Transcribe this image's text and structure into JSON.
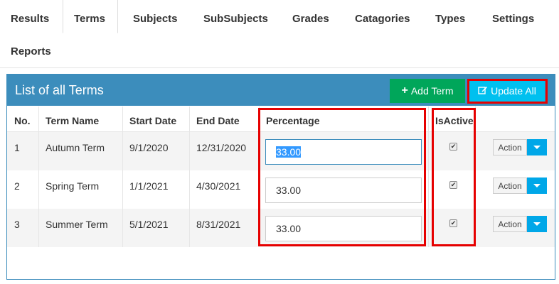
{
  "tabs": [
    {
      "label": "Results",
      "active": false
    },
    {
      "label": "Terms",
      "active": true
    },
    {
      "label": "Subjects",
      "active": false
    },
    {
      "label": "SubSubjects",
      "active": false
    },
    {
      "label": "Grades",
      "active": false
    },
    {
      "label": "Catagories",
      "active": false
    },
    {
      "label": "Types",
      "active": false
    },
    {
      "label": "Settings",
      "active": false
    },
    {
      "label": "Reports",
      "active": false
    }
  ],
  "panel": {
    "title": "List of all Terms",
    "add_label": "Add Term",
    "update_label": "Update All",
    "accent": "#3c8dbc"
  },
  "table": {
    "headers": {
      "no": "No.",
      "name": "Term Name",
      "start": "Start Date",
      "end": "End Date",
      "pct": "Percentage",
      "active": "IsActive"
    },
    "rows": [
      {
        "no": "1",
        "name": "Autumn Term",
        "start": "9/1/2020",
        "end": "12/31/2020",
        "pct": "33.00",
        "active": true,
        "action": "Action"
      },
      {
        "no": "2",
        "name": "Spring Term",
        "start": "1/1/2021",
        "end": "4/30/2021",
        "pct": "33.00",
        "active": true,
        "action": "Action"
      },
      {
        "no": "3",
        "name": "Summer Term",
        "start": "5/1/2021",
        "end": "8/31/2021",
        "pct": "33.00",
        "active": true,
        "action": "Action"
      }
    ]
  }
}
